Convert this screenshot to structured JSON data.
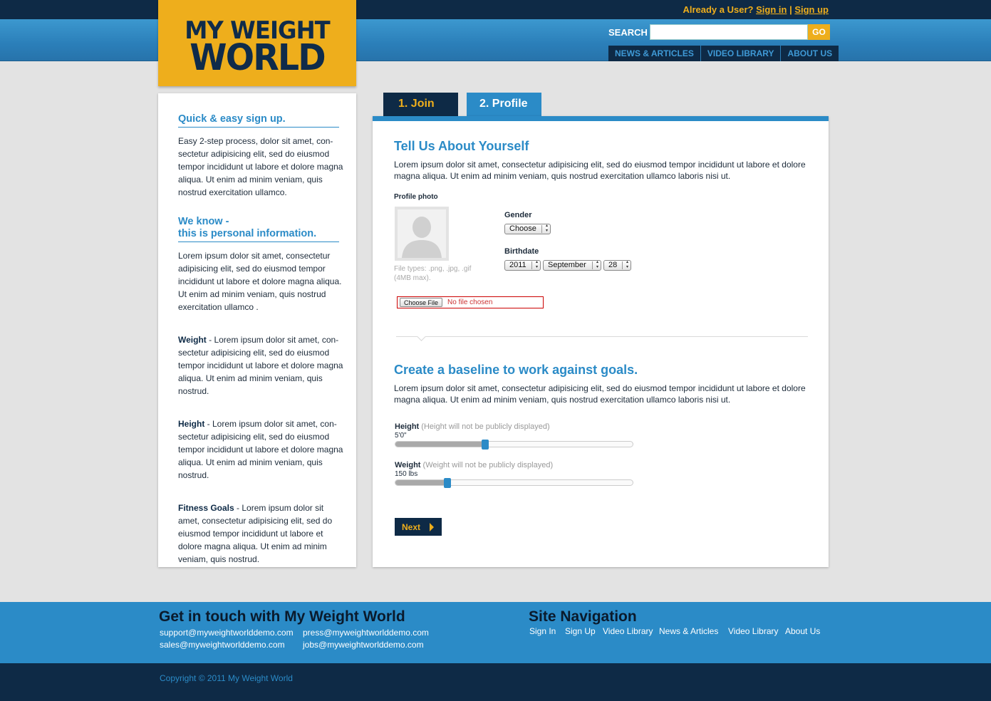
{
  "header": {
    "logo_line1": "MY WEIGHT",
    "logo_line2": "WORLD",
    "already_text": "Already a User?",
    "sign_in": "Sign in",
    "separator": "|",
    "sign_up": "Sign up",
    "search_label": "SEARCH",
    "search_value": "",
    "go_label": "GO",
    "nav": [
      "NEWS & ARTICLES",
      "VIDEO LIBRARY",
      "ABOUT US"
    ]
  },
  "sidebar": {
    "heading1": "Quick & easy sign up.",
    "para1": "Easy 2-step process, dolor sit amet, con-sectetur adipisicing elit, sed do eiusmod tempor incididunt ut labore et dolore magna aliqua. Ut enim ad minim veniam, quis nostrud exercitation ullamco.",
    "heading2_line1": "We know -",
    "heading2_line2": "this is personal information.",
    "para2": "Lorem ipsum dolor sit amet, consectetur adipisicing elit, sed do eiusmod tempor incididunt ut labore et dolore magna aliqua. Ut enim ad minim veniam, quis nostrud exercitation ullamco .",
    "weight_term": "Weight",
    "weight_text": " - Lorem ipsum dolor sit amet, con-sectetur adipisicing elit, sed do eiusmod tempor incididunt ut labore et dolore magna aliqua. Ut enim ad minim veniam, quis nostrud.",
    "height_term": "Height",
    "height_text": " - Lorem ipsum dolor sit amet, con-sectetur adipisicing elit, sed do eiusmod tempor incididunt ut labore et dolore magna aliqua. Ut enim ad minim veniam, quis nostrud.",
    "goals_term": "Fitness Goals",
    "goals_text": " - Lorem ipsum dolor sit amet, consectetur adipisicing elit, sed do eiusmod tempor incididunt ut labore et dolore magna aliqua. Ut enim ad minim veniam, quis nostrud."
  },
  "tabs": {
    "join": "1. Join",
    "profile": "2. Profile"
  },
  "main": {
    "heading1": "Tell Us About Yourself",
    "intro": "Lorem ipsum dolor sit amet, consectetur adipisicing elit, sed do eiusmod tempor incididunt ut labore et dolore magna aliqua. Ut enim ad minim veniam, quis nostrud exercitation ullamco laboris nisi ut.",
    "photo_label": "Profile photo",
    "file_types": "File types: .png, .jpg, .gif (4MB max).",
    "choose_file": "Choose File",
    "no_file": "No file chosen",
    "gender_label": "Gender",
    "gender_value": "Choose",
    "birthdate_label": "Birthdate",
    "birth_year": "2011",
    "birth_month": "September",
    "birth_day": "28",
    "heading2": "Create a baseline to work against goals.",
    "intro2": "Lorem ipsum dolor sit amet, consectetur adipisicing elit, sed do eiusmod tempor incididunt ut labore et dolore magna aliqua. Ut enim ad minim veniam, quis nostrud exercitation ullamco laboris nisi ut.",
    "height_label": "Height",
    "height_note": "(Height will not be publicly displayed)",
    "height_value": "5'0\"",
    "height_fraction": 0.38,
    "weight_label": "Weight",
    "weight_note": "(Weight will not be publicly displayed)",
    "weight_value": "150 lbs",
    "weight_fraction": 0.22,
    "next_label": "Next"
  },
  "footer": {
    "contact_heading": "Get in touch with My Weight World",
    "emails": [
      "support@myweightworlddemo.com",
      "sales@myweightworlddemo.com",
      "press@myweightworlddemo.com",
      "jobs@myweightworlddemo.com"
    ],
    "nav_heading": "Site Navigation",
    "nav_links": [
      "Sign In",
      "Sign Up",
      "Video Library",
      "News & Articles",
      "Video Library",
      "About Us"
    ],
    "copyright": "Copyright © 2011 My Weight World"
  },
  "colors": {
    "navy": "#0e2a46",
    "blue": "#2b8bc7",
    "gold": "#eeae1c"
  }
}
